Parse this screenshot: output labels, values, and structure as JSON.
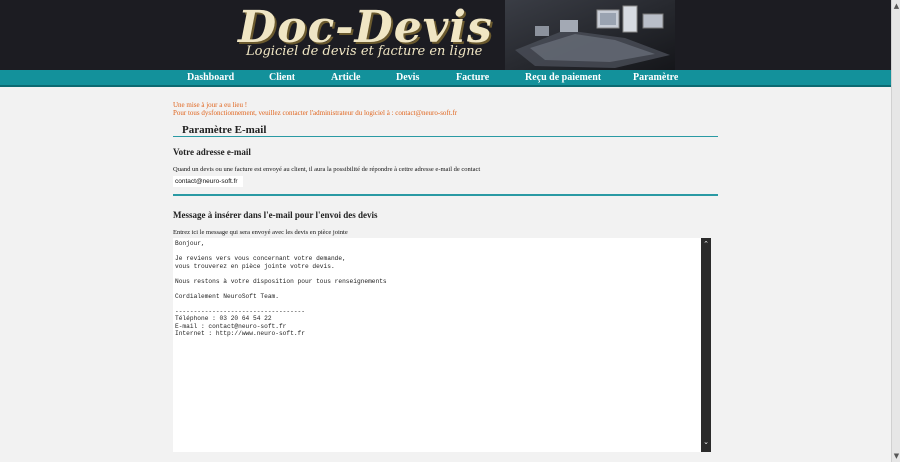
{
  "header": {
    "logo_title": "Doc-Devis",
    "logo_subtitle": "Logiciel de devis et facture en ligne"
  },
  "nav": {
    "items": [
      {
        "label": "Dashboard"
      },
      {
        "label": "Client"
      },
      {
        "label": "Article"
      },
      {
        "label": "Devis"
      },
      {
        "label": "Facture"
      },
      {
        "label": "Reçu de paiement"
      },
      {
        "label": "Paramètre"
      }
    ]
  },
  "notice": {
    "line1": "Une mise à jour a eu lieu !",
    "line2": "Pour tous dysfonctionnement, veuillez contacter l'administrateur du logiciel à : contact@neuro-soft.fr"
  },
  "page": {
    "title": "Paramètre E-mail"
  },
  "email_section": {
    "heading": "Votre adresse e-mail",
    "description": "Quand un devis ou une facture est envoyé au client, il aura la possibilité de répondre à cettre adresse e-mail de contact",
    "value": "contact@neuro-soft.fr"
  },
  "message_section": {
    "heading": "Message à insérer dans l'e-mail pour l'envoi des devis",
    "description": "Entrez ici le message qui sera envoyé avec les devis en pièce jointe",
    "message": "Bonjour,\n\nJe reviens vers vous concernant votre demande,\nvous trouverez en pièce jointe votre devis.\n\nNous restons à votre disposition pour tous renseignements\n\nCordialement NeuroSoft Team.\n\n-----------------------------------\nTéléphone : 03 20 64 54 22\nE-mail : contact@neuro-soft.fr\nInternet : http://www.neuro-soft.fr"
  },
  "colors": {
    "nav_bg": "#13919b",
    "accent_rule": "#2a9aa4",
    "notice_text": "#e0651e",
    "banner_bg": "#1c1c22"
  }
}
